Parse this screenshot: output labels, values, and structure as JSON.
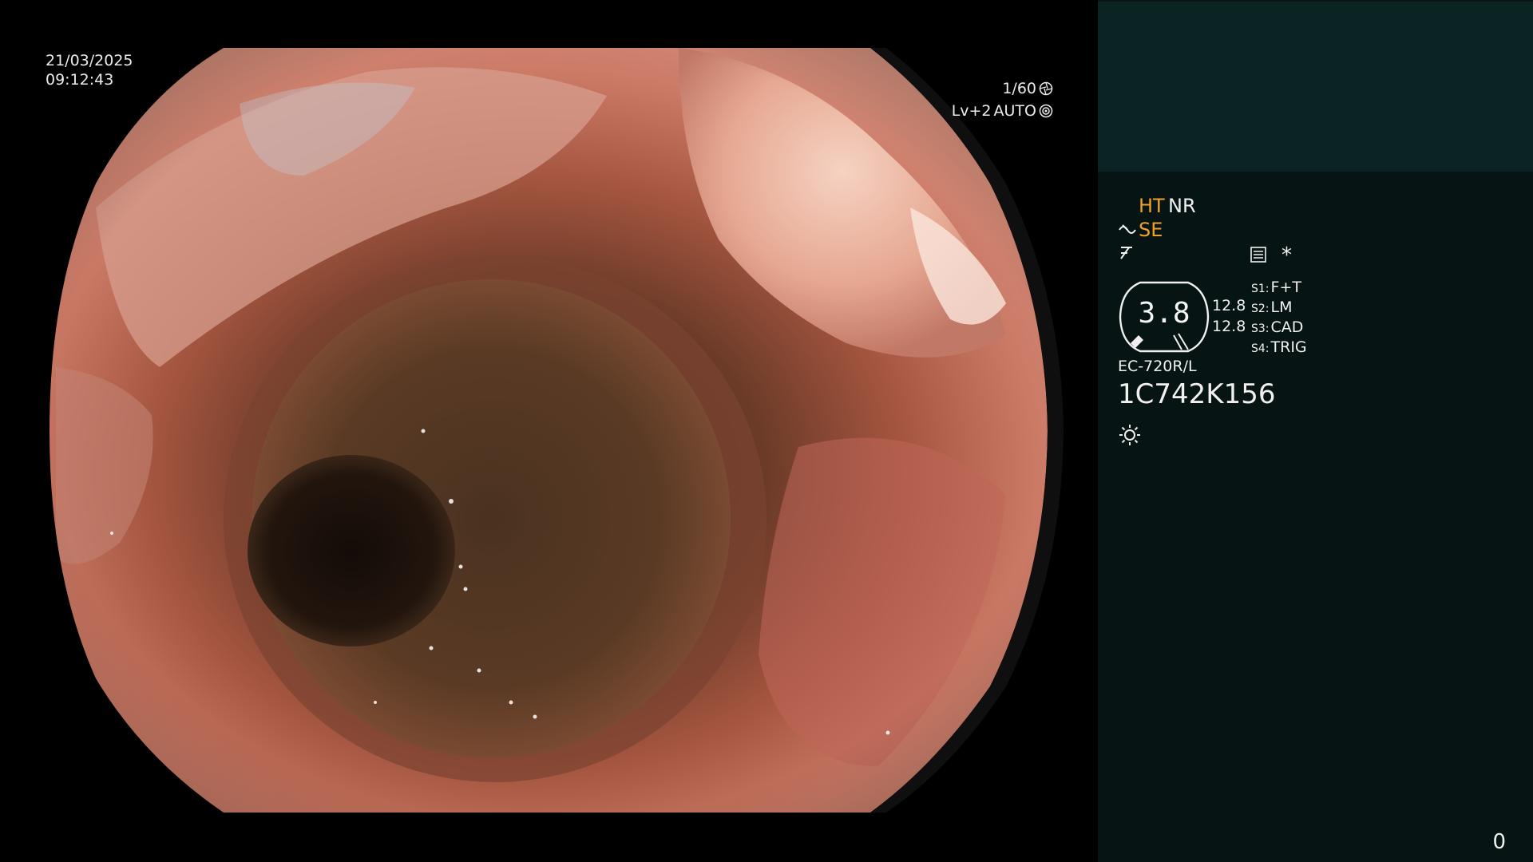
{
  "overlay": {
    "date": "21/03/2025",
    "time": "09:12:43",
    "shutter": "1/60",
    "level": "Lv+2",
    "iris_mode": "AUTO"
  },
  "panel": {
    "mode_ht": "HT",
    "mode_nr": "NR",
    "mode_se": "SE",
    "asterisk": "*",
    "gauge_value": "3.8",
    "value_1": "12.8",
    "value_2": "12.8",
    "switches": [
      {
        "key": "S1:",
        "value": "F+T"
      },
      {
        "key": "S2:",
        "value": "LM"
      },
      {
        "key": "S3:",
        "value": "CAD"
      },
      {
        "key": "S4:",
        "value": "TRIG"
      }
    ],
    "scope_model": "EC-720R/L",
    "scope_serial": "1C742K156",
    "image_counter": "0"
  },
  "colors": {
    "background": "#000000",
    "panel": "#061513",
    "panel_top": "#0c2324",
    "accent_orange": "#f1a12a",
    "text": "#f0f0f0"
  },
  "icons": {
    "shutter": "shutter-aperture-icon",
    "iris": "iris-icon",
    "se": "structure-enhancement-icon",
    "enh": "enhancement-icon",
    "settings": "settings-list-icon",
    "light": "light-source-icon"
  }
}
